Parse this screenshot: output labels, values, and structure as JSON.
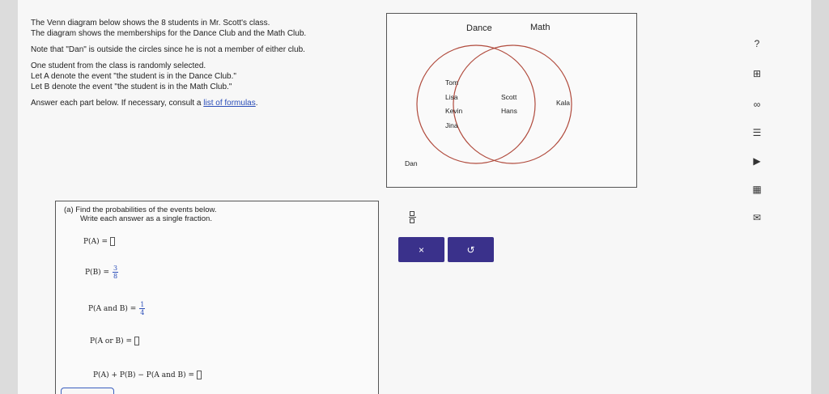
{
  "problem": {
    "line1": "The Venn diagram below shows the 8 students in Mr. Scott's class.",
    "line2": "The diagram shows the memberships for the Dance Club and the Math Club.",
    "line3": "Note that \"Dan\" is outside the circles since he is not a member of either club.",
    "line4": "One student from the class is randomly selected.",
    "line5": "Let A denote the event \"the student is in the Dance Club.\"",
    "line6": "Let B denote the event \"the student is in the Math Club.\"",
    "line7_prefix": "Answer each part below. If necessary, consult a ",
    "line7_link": "list of formulas",
    "line7_suffix": "."
  },
  "venn": {
    "label_a": "Dance",
    "label_b": "Math",
    "only_a": [
      "Tom",
      "Lisa",
      "Kevin",
      "Jina"
    ],
    "both": [
      "Scott",
      "Hans"
    ],
    "only_b": "Kala",
    "outside": "Dan",
    "circle_color": "#b04a3c"
  },
  "part_a": {
    "line1": "(a) Find the probabilities of the events below.",
    "line2": "Write each answer as a single fraction.",
    "rows": {
      "pa": "P(A) =",
      "pb": "P(B) =",
      "pb_num": "3",
      "pb_den": "8",
      "pab": "P(A and B) =",
      "pab_num": "1",
      "pab_den": "4",
      "paorb": "P(A or B) =",
      "sum": "P(A) + P(B) − P(A and B) ="
    }
  },
  "buttons": {
    "clear": "×",
    "undo": "↺"
  },
  "sidebar": {
    "help": "?",
    "book": "⊞",
    "infinity": "∞",
    "list": "☰",
    "video": "▶",
    "calc": "▦",
    "mail": "✉"
  },
  "colors": {
    "button": "#3a318b",
    "link": "#2a4db8"
  }
}
